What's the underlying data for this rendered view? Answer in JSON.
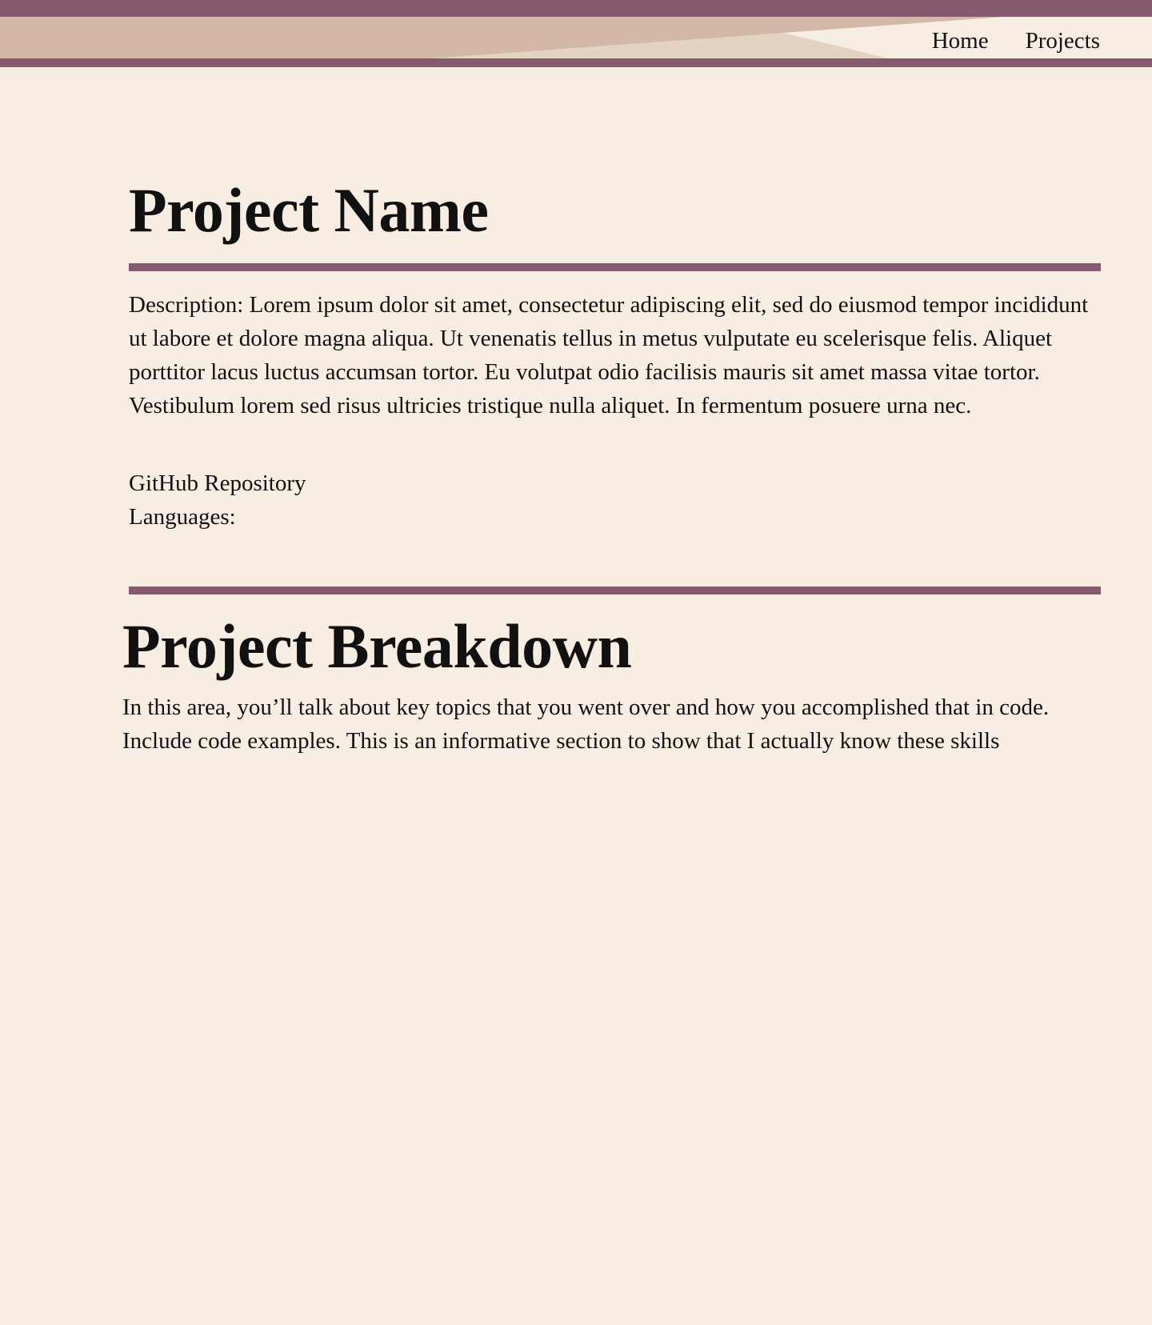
{
  "theme": {
    "background": "#f7ede3",
    "accent": "#87596f",
    "header_tan": "#d3b8a8",
    "header_light_tan": "#e2d3c3",
    "header_cream": "#f7ede3",
    "text": "#111111"
  },
  "nav": {
    "items": [
      {
        "label": "Home"
      },
      {
        "label": "Projects"
      }
    ]
  },
  "project": {
    "title": "Project Name",
    "description": "Description: Lorem ipsum dolor sit amet, consectetur adipiscing elit, sed do eiusmod tempor incididunt ut labore et dolore magna aliqua. Ut venenatis tellus in metus vulputate eu scelerisque felis. Aliquet porttitor lacus luctus accumsan tortor. Eu volutpat odio facilisis mauris sit amet massa vitae tortor. Vestibulum lorem sed risus ultricies tristique nulla aliquet. In fermentum posuere urna nec.",
    "github_label": "GitHub Repository",
    "languages_label": "Languages:"
  },
  "breakdown": {
    "title": "Project Breakdown",
    "text": "In this area, you’ll talk about key topics that you went over and how you accomplished that in code. Include code examples. This is an informative section to show that I actually know these skills"
  }
}
